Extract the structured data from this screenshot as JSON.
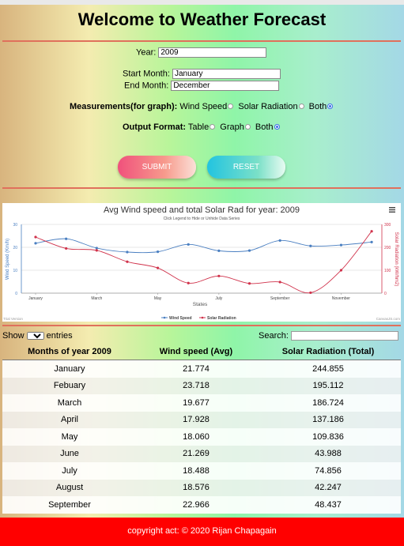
{
  "page": {
    "title": "Welcome to Weather Forecast"
  },
  "form": {
    "year_label": "Year:",
    "year_value": "2009",
    "start_label": "Start Month:",
    "start_value": "January",
    "end_label": "End Month:",
    "end_value": "December",
    "measure_label": "Measurements(for graph):",
    "measure_options": [
      "Wind Speed",
      "Solar Radiation",
      "Both"
    ],
    "output_label": "Output Format:",
    "output_options": [
      "Table",
      "Graph",
      "Both"
    ],
    "submit_label": "SUBMIT",
    "reset_label": "RESET"
  },
  "chart_data": {
    "type": "line",
    "title": "Avg Wind speed and total Solar Rad for year: 2009",
    "subtitle": "Click Legend to Hide or Unhide Data Series",
    "xlabel": "States",
    "ylabel_left": "Wind Speed (Km/h)",
    "ylabel_right": "Solar Radiation (kW/hm2)",
    "categories": [
      "January",
      "Febuary",
      "March",
      "April",
      "May",
      "June",
      "July",
      "August",
      "September",
      "October",
      "November",
      "December"
    ],
    "x_tick_labels": [
      "January",
      "March",
      "May",
      "July",
      "September",
      "November"
    ],
    "y_left_ticks": [
      "0",
      "10",
      "20",
      "30"
    ],
    "y_right_ticks": [
      "0",
      "100",
      "200",
      "300"
    ],
    "y_left_range": [
      0,
      30
    ],
    "y_right_range": [
      0,
      300
    ],
    "series": [
      {
        "name": "Wind Speed",
        "color": "#4a7fc1",
        "axis": "left",
        "values": [
          21.774,
          23.718,
          19.677,
          17.928,
          18.06,
          21.269,
          18.488,
          18.576,
          22.966,
          20.6,
          21.0,
          22.3
        ]
      },
      {
        "name": "Solar Radiation",
        "color": "#d0324b",
        "axis": "right",
        "values": [
          244.855,
          195.112,
          186.724,
          137.186,
          109.836,
          43.988,
          74.856,
          42.247,
          48.437,
          2.0,
          100.0,
          270.0
        ]
      }
    ],
    "grid": true,
    "legend": "bottom",
    "watermark_left": "Trial Version",
    "watermark_right": "CanvasJS.com",
    "menu_icon": "hamburger-icon"
  },
  "table": {
    "show_label": "Show",
    "entries_value": "10",
    "entries_label": "entries",
    "search_label": "Search:",
    "headers": [
      "Months of year 2009",
      "Wind speed (Avg)",
      "Solar Radiation (Total)"
    ],
    "rows": [
      [
        "January",
        "21.774",
        "244.855"
      ],
      [
        "Febuary",
        "23.718",
        "195.112"
      ],
      [
        "March",
        "19.677",
        "186.724"
      ],
      [
        "April",
        "17.928",
        "137.186"
      ],
      [
        "May",
        "18.060",
        "109.836"
      ],
      [
        "June",
        "21.269",
        "43.988"
      ],
      [
        "July",
        "18.488",
        "74.856"
      ],
      [
        "August",
        "18.576",
        "42.247"
      ],
      [
        "September",
        "22.966",
        "48.437"
      ]
    ]
  },
  "footer": {
    "text": "copyright act: © 2020 Rijan Chapagain"
  },
  "colors": {
    "accent_red": "#ff0000",
    "divider": "#e0705c",
    "radio_selected": "#3b6ee6"
  }
}
